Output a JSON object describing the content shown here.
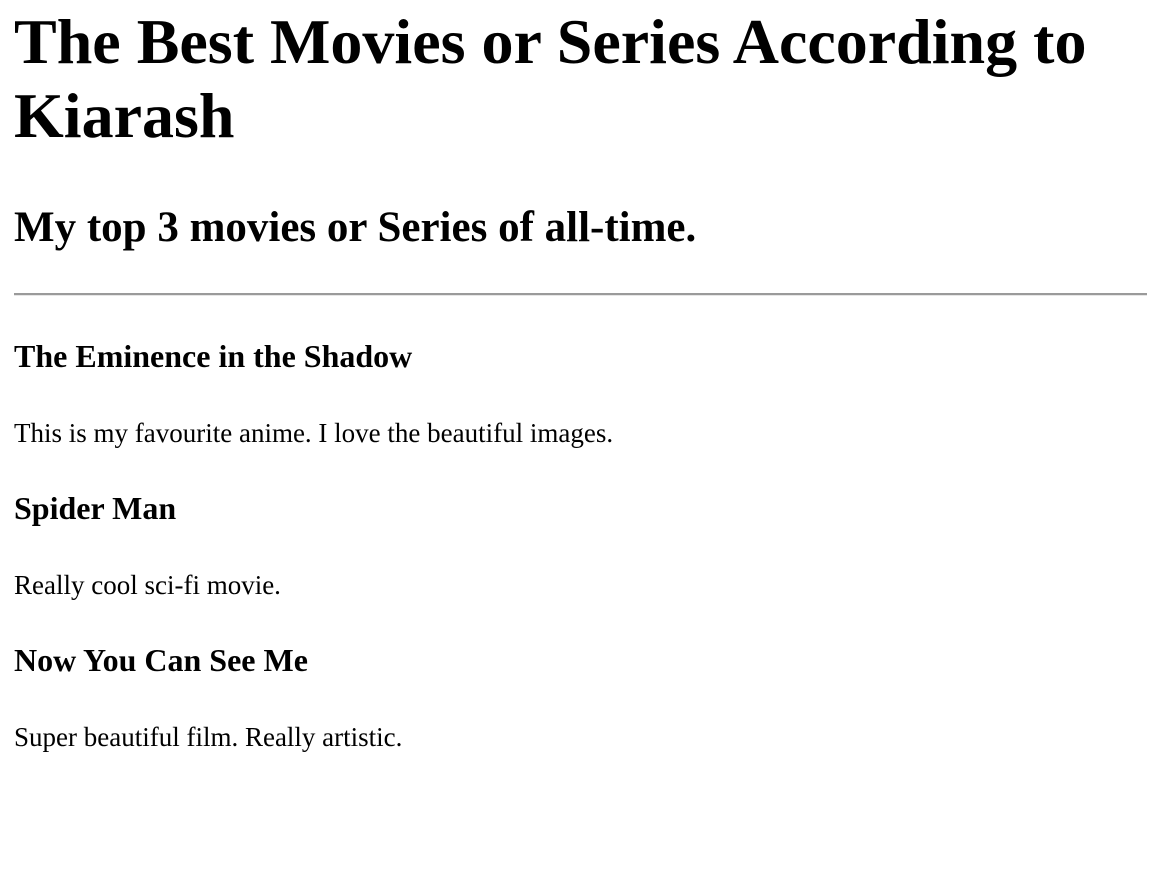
{
  "page": {
    "title": "The Best Movies or Series According to Kiarash",
    "subtitle": "My top 3 movies or Series of all-time."
  },
  "entries": [
    {
      "title": "The Eminence in the Shadow",
      "description": "This is my favourite anime. I love the beautiful images."
    },
    {
      "title": "Spider Man",
      "description": "Really cool sci-fi movie."
    },
    {
      "title": "Now You Can See Me",
      "description": "Super beautiful film. Really artistic."
    }
  ]
}
